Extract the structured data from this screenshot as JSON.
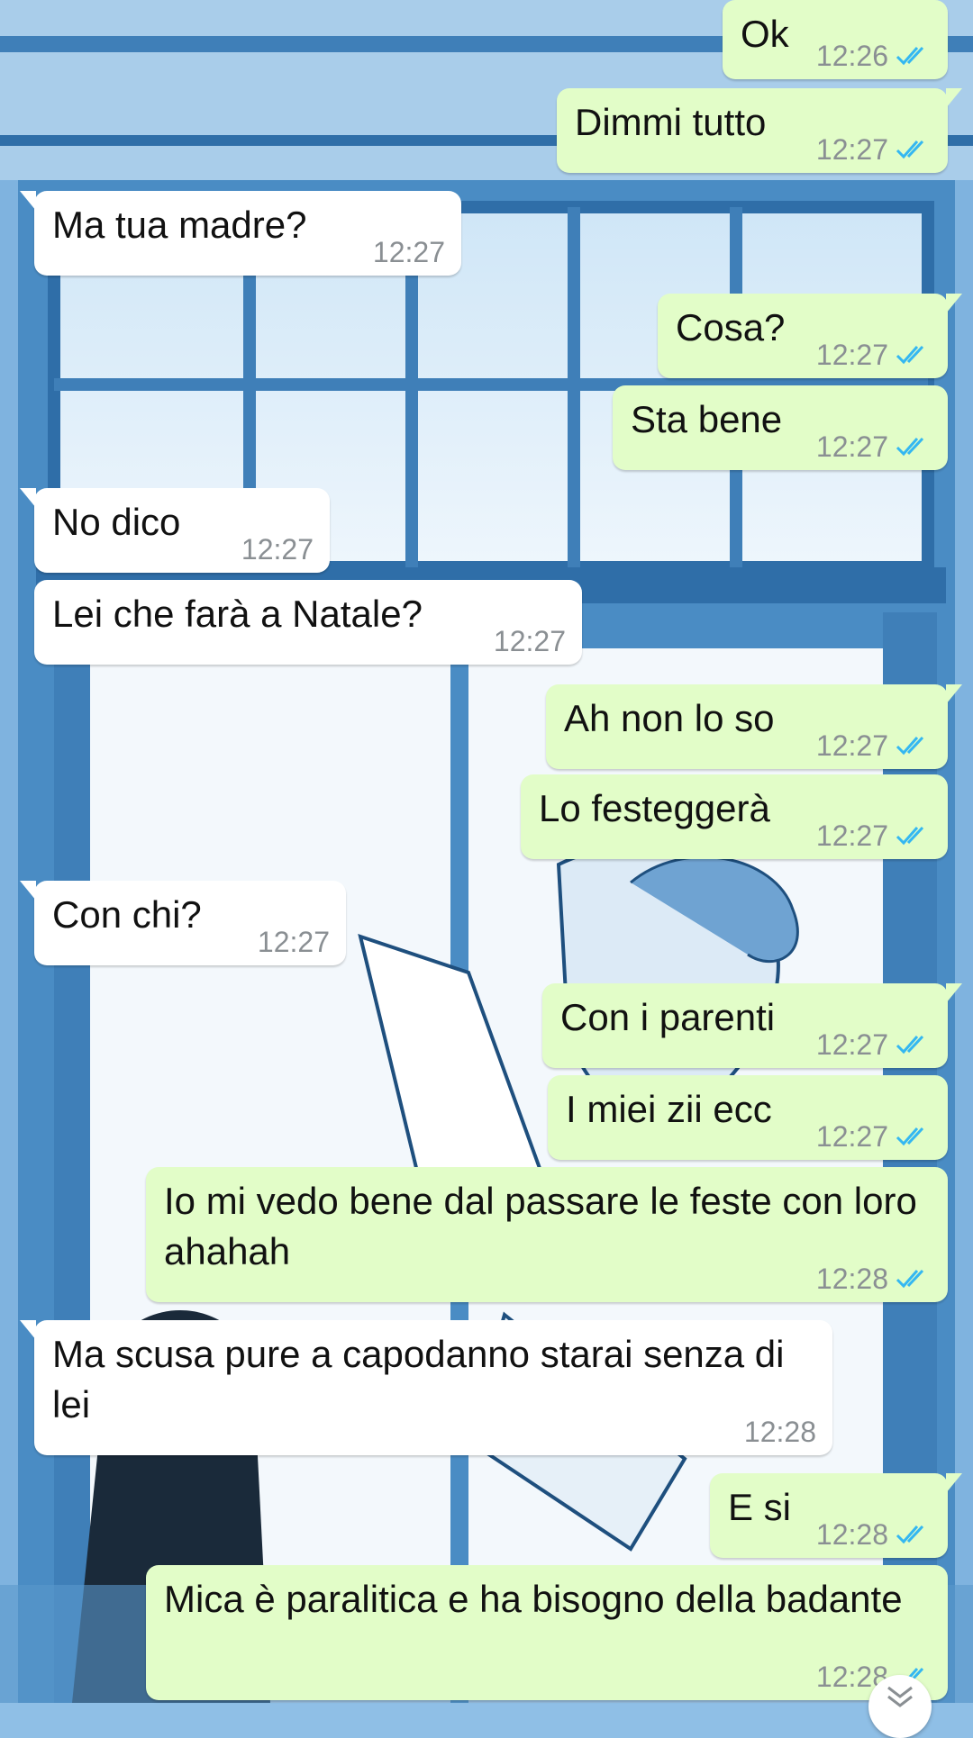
{
  "colors": {
    "outgoing_bubble": "#e2fdc8",
    "incoming_bubble": "#ffffff",
    "timestamp": "#8a8f93",
    "read_ticks": "#34b7f1"
  },
  "messages": [
    {
      "direction": "out",
      "text": "Ok",
      "time": "12:26",
      "status": "read"
    },
    {
      "direction": "out",
      "text": "Dimmi tutto",
      "time": "12:27",
      "status": "read"
    },
    {
      "direction": "in",
      "text": "Ma tua madre?",
      "time": "12:27"
    },
    {
      "direction": "out",
      "text": "Cosa?",
      "time": "12:27",
      "status": "read"
    },
    {
      "direction": "out",
      "text": "Sta bene",
      "time": "12:27",
      "status": "read"
    },
    {
      "direction": "in",
      "text": "No dico",
      "time": "12:27"
    },
    {
      "direction": "in",
      "text": "Lei che farà a Natale?",
      "time": "12:27"
    },
    {
      "direction": "out",
      "text": "Ah non lo so",
      "time": "12:27",
      "status": "read"
    },
    {
      "direction": "out",
      "text": "Lo festeggerà",
      "time": "12:27",
      "status": "read"
    },
    {
      "direction": "in",
      "text": "Con chi?",
      "time": "12:27"
    },
    {
      "direction": "out",
      "text": "Con i parenti",
      "time": "12:27",
      "status": "read"
    },
    {
      "direction": "out",
      "text": "I miei zii ecc",
      "time": "12:27",
      "status": "read"
    },
    {
      "direction": "out",
      "text": "Io mi vedo bene dal passare le feste con loro ahahah",
      "time": "12:28",
      "status": "read"
    },
    {
      "direction": "in",
      "text": "Ma scusa pure a capodanno starai senza di lei",
      "time": "12:28"
    },
    {
      "direction": "out",
      "text": "E si",
      "time": "12:28",
      "status": "read"
    },
    {
      "direction": "out",
      "text": "Mica è paralitica e ha bisogno della badante",
      "time": "12:28",
      "status": "read"
    }
  ],
  "scroll_button": {
    "icon": "double-chevron-down-icon"
  }
}
